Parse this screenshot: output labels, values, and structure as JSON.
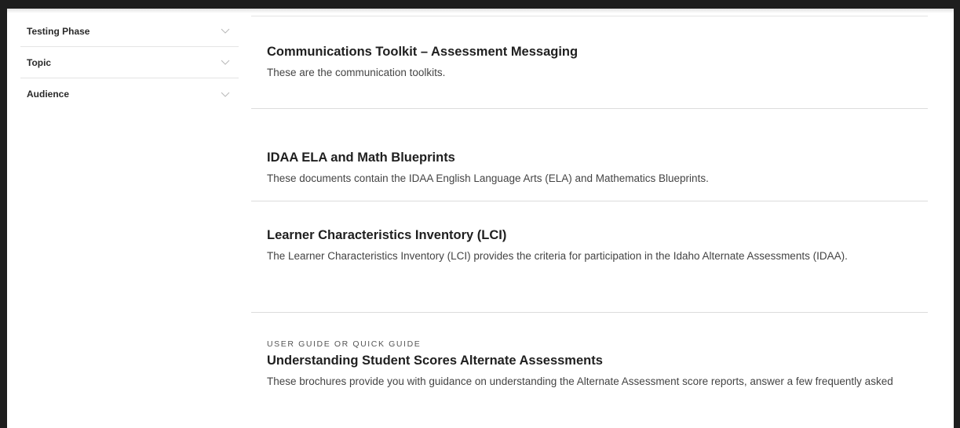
{
  "filters": [
    {
      "label": "Testing Phase",
      "icon": "chevron-down-icon"
    },
    {
      "label": "Topic",
      "icon": "chevron-down-icon"
    },
    {
      "label": "Audience",
      "icon": "chevron-down-icon"
    }
  ],
  "results": [
    {
      "eyebrow": "",
      "title": "Communications Toolkit – Assessment Messaging",
      "description": "These are the communication toolkits."
    },
    {
      "eyebrow": "",
      "title": "IDAA ELA and Math Blueprints",
      "description": "These documents contain the IDAA English Language Arts (ELA) and Mathematics Blueprints."
    },
    {
      "eyebrow": "",
      "title": "Learner Characteristics Inventory (LCI)",
      "description": "The Learner Characteristics Inventory (LCI) provides the criteria for participation in the Idaho Alternate Assessments (IDAA)."
    },
    {
      "eyebrow": "USER GUIDE OR QUICK GUIDE",
      "title": "Understanding Student Scores Alternate Assessments",
      "description": "These brochures provide you with guidance on understanding the Alternate Assessment score reports, answer a few frequently asked"
    }
  ],
  "colors": {
    "frame": "#1e1e1e",
    "divider": "#dcdcdc",
    "text": "#222222"
  }
}
